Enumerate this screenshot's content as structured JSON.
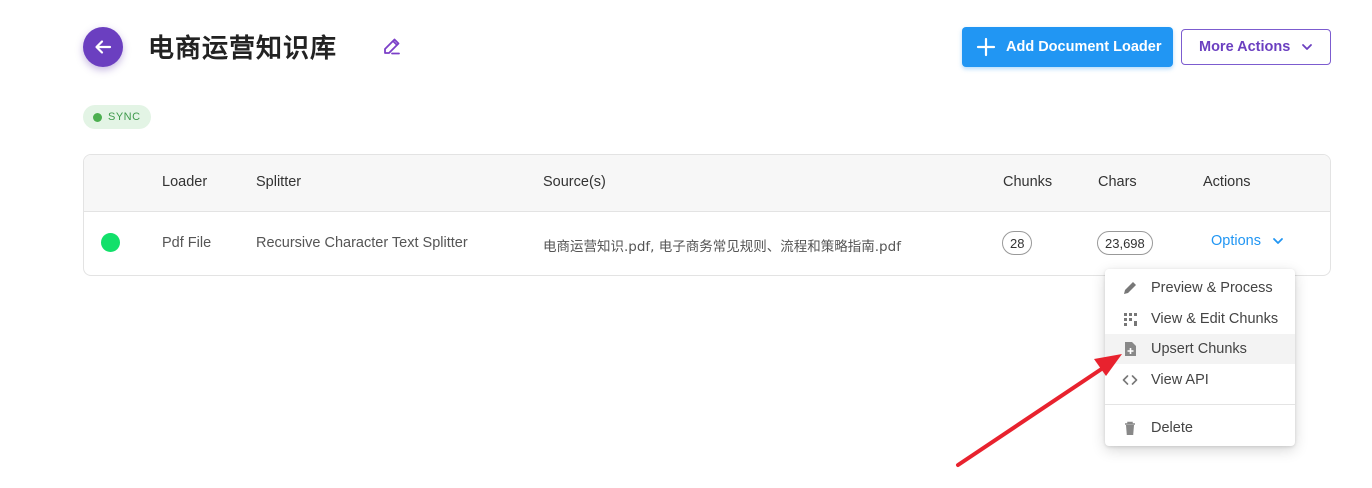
{
  "header": {
    "title": "电商运营知识库",
    "add_button": "Add Document Loader",
    "more_button": "More Actions"
  },
  "sync_badge": "SYNC",
  "table": {
    "headers": [
      "Loader",
      "Splitter",
      "Source(s)",
      "Chunks",
      "Chars",
      "Actions"
    ],
    "rows": [
      {
        "loader": "Pdf File",
        "splitter": "Recursive Character Text Splitter",
        "sources": "电商运营知识.pdf, 电子商务常见规则、流程和策略指南.pdf",
        "chunks": "28",
        "chars": "23,698",
        "action": "Options"
      }
    ]
  },
  "menu": {
    "items": [
      {
        "label": "Preview & Process",
        "icon": "pencil-icon"
      },
      {
        "label": "View & Edit Chunks",
        "icon": "grid-dots-icon"
      },
      {
        "label": "Upsert Chunks",
        "icon": "file-add-icon"
      },
      {
        "label": "View API",
        "icon": "code-icon"
      },
      {
        "label": "Delete",
        "icon": "trash-icon"
      }
    ]
  },
  "colors": {
    "primary_purple": "#6b3fc0",
    "accent_blue": "#2196f3",
    "status_green": "#12e06a",
    "arrow_red": "#e8222e"
  }
}
